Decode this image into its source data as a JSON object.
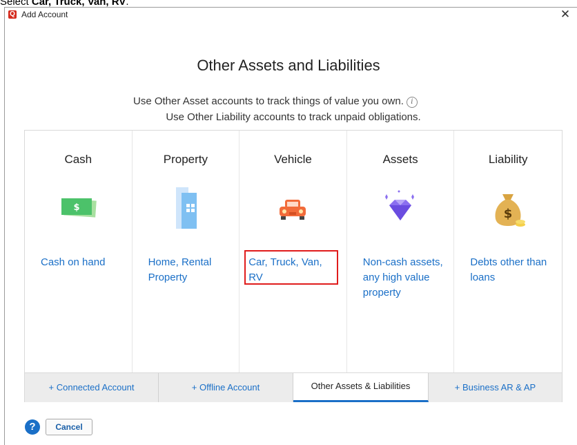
{
  "instruction": {
    "prefix": "Select ",
    "target": "Car, Truck, Van, RV",
    "suffix": "."
  },
  "window": {
    "title": "Add Account",
    "app_icon_letter": "Q",
    "close_glyph": "✕"
  },
  "header": {
    "title": "Other Assets and Liabilities",
    "line1": "Use Other Asset accounts to track things of value you own.",
    "line2": "Use Other Liability accounts to track unpaid obligations.",
    "info_glyph": "i"
  },
  "cards": [
    {
      "title": "Cash",
      "description": "Cash on hand",
      "icon": "cash-icon"
    },
    {
      "title": "Property",
      "description": "Home, Rental Property",
      "icon": "building-icon"
    },
    {
      "title": "Vehicle",
      "description": "Car, Truck, Van, RV",
      "icon": "car-icon"
    },
    {
      "title": "Assets",
      "description": "Non-cash assets, any high value property",
      "icon": "diamond-icon"
    },
    {
      "title": "Liability",
      "description": "Debts other than loans",
      "icon": "money-bag-icon"
    }
  ],
  "tabs": [
    {
      "label": "+ Connected Account",
      "active": false
    },
    {
      "label": "+ Offline Account",
      "active": false
    },
    {
      "label": "Other Assets & Liabilities",
      "active": true
    },
    {
      "label": "+ Business AR & AP",
      "active": false
    }
  ],
  "footer": {
    "help_glyph": "?",
    "cancel_label": "Cancel"
  },
  "colors": {
    "link": "#1a6fc7",
    "highlight": "#e01b1b",
    "brand": "#d52b1e"
  }
}
